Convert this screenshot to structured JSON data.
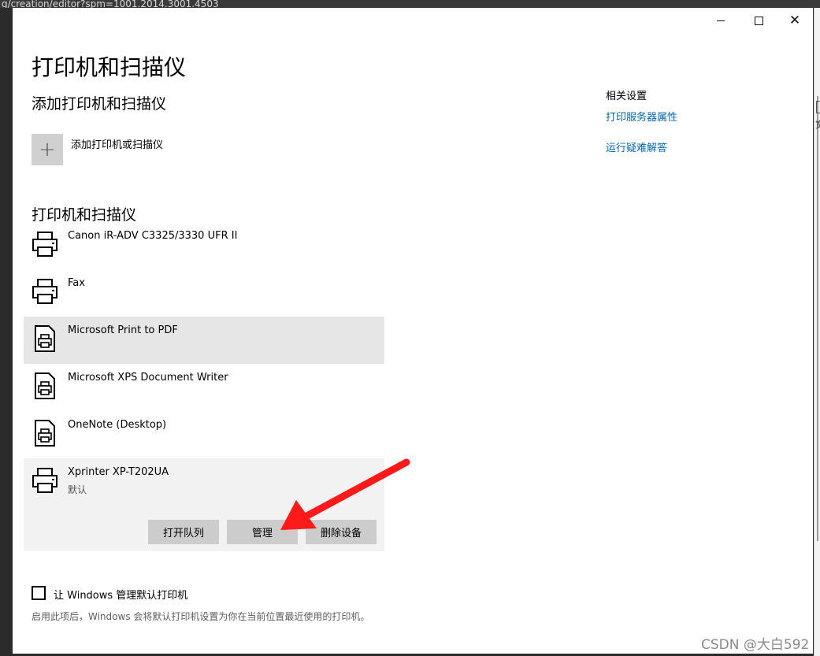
{
  "browser": {
    "address_fragment": "g/creation/editor?spm=1001.2014.3001.4503"
  },
  "window": {
    "minimize_icon": "minimize-icon",
    "maximize_icon": "maximize-icon",
    "close_glyph": "✕"
  },
  "page": {
    "title": "打印机和扫描仪",
    "add_section": {
      "heading": "添加打印机和扫描仪",
      "add_glyph": "+",
      "add_label": "添加打印机或扫描仪"
    },
    "list_section": {
      "heading": "打印机和扫描仪"
    },
    "printers": [
      {
        "name": "Canon iR-ADV C3325/3330 UFR II",
        "icon": "printer-icon"
      },
      {
        "name": "Fax",
        "icon": "printer-icon"
      },
      {
        "name": "Microsoft Print to PDF",
        "icon": "document-printer-icon"
      },
      {
        "name": "Microsoft XPS Document Writer",
        "icon": "document-printer-icon"
      },
      {
        "name": "OneNote (Desktop)",
        "icon": "document-printer-icon"
      },
      {
        "name": "Xprinter XP-T202UA",
        "icon": "printer-icon",
        "status": "默认"
      }
    ],
    "actions": {
      "open_queue": "打开队列",
      "manage": "管理",
      "remove": "删除设备"
    },
    "default_checkbox": {
      "label": "让 Windows 管理默认打印机",
      "checked": false,
      "note": "启用此项后，Windows 会将默认打印机设置为你在当前位置最近使用的打印机。"
    }
  },
  "related": {
    "heading": "相关设置",
    "links": [
      "打印服务器属性",
      "运行疑难解答"
    ]
  },
  "annotation": {
    "arrow_color": "#ff1a1a"
  },
  "watermark": "CSDN @大白592",
  "colors": {
    "link": "#0067b8",
    "hover_row": "#e6e6e6",
    "selected_row": "#f2f2f2",
    "button": "#cccccc"
  }
}
